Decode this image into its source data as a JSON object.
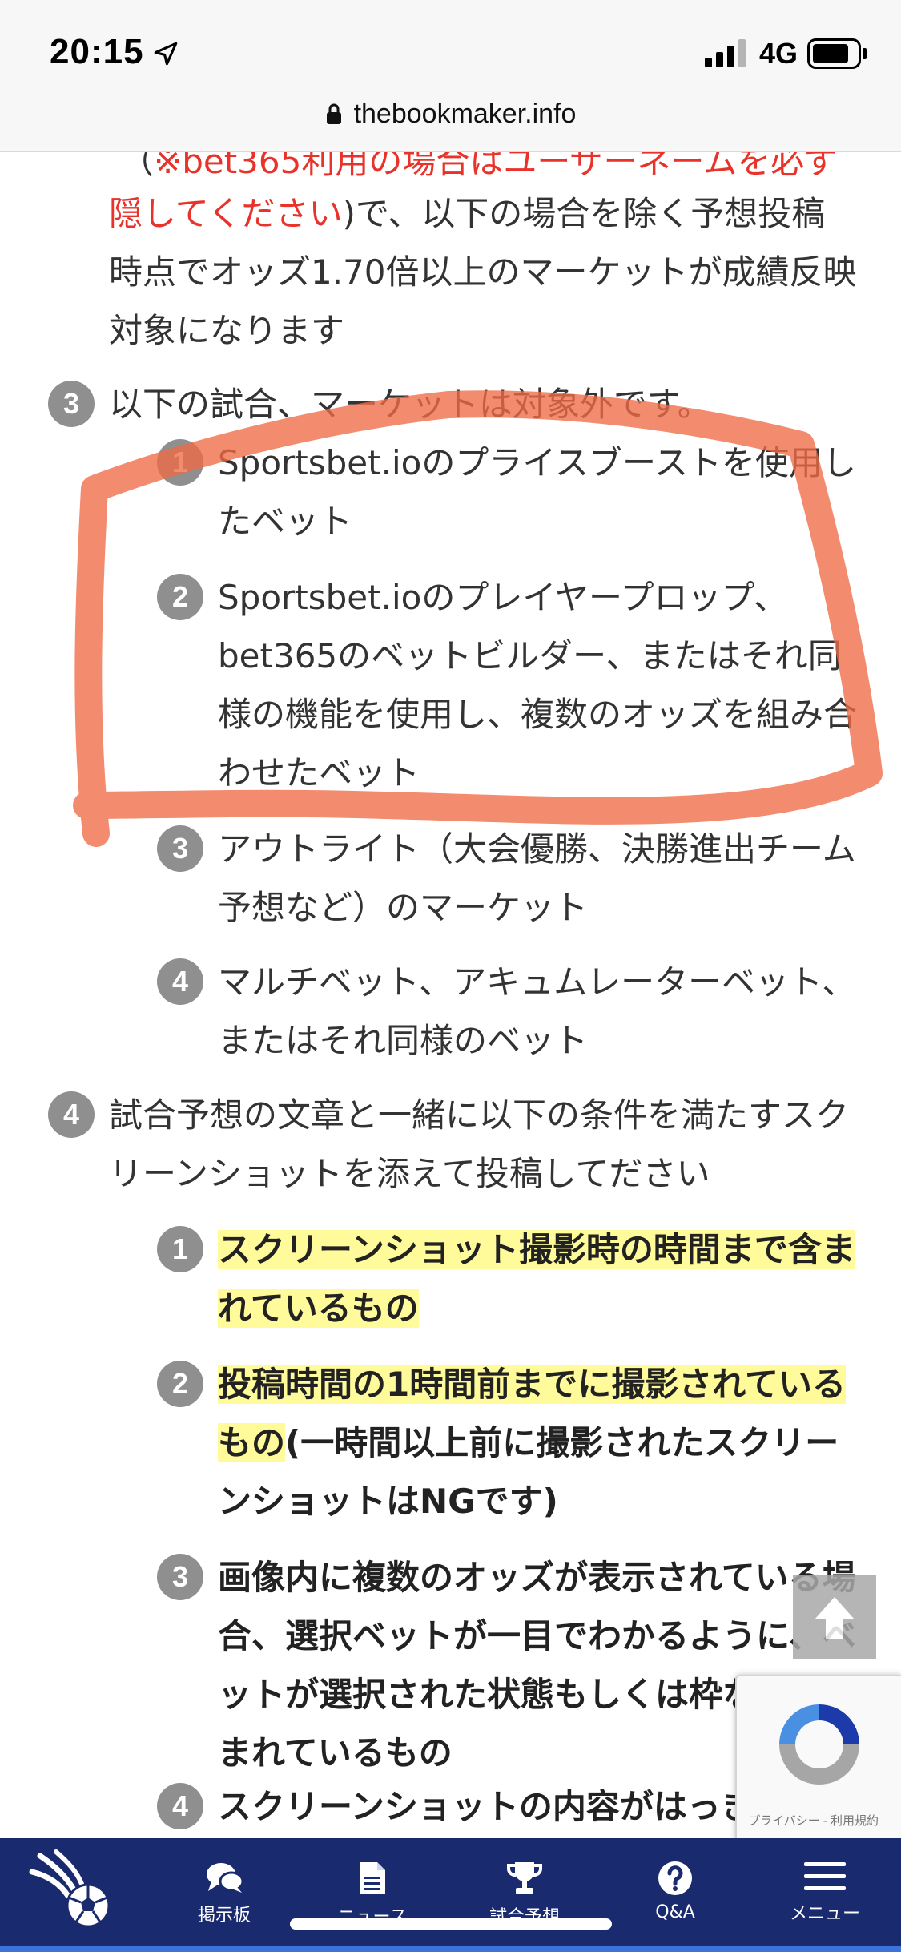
{
  "status_bar": {
    "time": "20:15",
    "network": "4G"
  },
  "url_bar": {
    "url": "thebookmaker.info"
  },
  "article": {
    "intro_paren_partial": "（",
    "intro_red_partial": "※bet365利用の場合はユーザーネームを必ず",
    "intro_red_line2": "隠してください",
    "intro_line2_rest": ")で、以下の場合を除く予想投稿",
    "intro_line3": "時点でオッズ1.70倍以上のマーケットが成績反映",
    "intro_line4": "対象になります",
    "section3": {
      "number": "3",
      "title": "以下の試合、マーケットは対象外です。",
      "items": [
        {
          "number": "1",
          "lines": [
            "Sportsbet.ioのプライスブーストを使用し",
            "たベット"
          ]
        },
        {
          "number": "2",
          "lines": [
            "Sportsbet.ioのプレイヤープロップ、",
            "bet365のベットビルダー、またはそれ同",
            "様の機能を使用し、複数のオッズを組み合",
            "わせたベット"
          ]
        },
        {
          "number": "3",
          "lines": [
            "アウトライト（大会優勝、決勝進出チーム",
            "予想など）のマーケット"
          ]
        },
        {
          "number": "4",
          "lines": [
            "マルチベット、アキュムレーターベット、",
            "またはそれ同様のベット"
          ]
        }
      ]
    },
    "section4": {
      "number": "4",
      "title_line1": "試合予想の文章と一緒に以下の条件を満たすスク",
      "title_line2": "リーンショットを添えて投稿してださい",
      "items": [
        {
          "number": "1",
          "hl_line1": "スクリーンショット撮影時の時間まで含ま",
          "hl_line2": "れているもの"
        },
        {
          "number": "2",
          "hl_line1": "投稿時間の1時間前までに撮影されている",
          "hl_line2": "もの",
          "rest_line2": "(一時間以上前に撮影されたスクリー",
          "line3": "ンショットはNGです)"
        },
        {
          "number": "3",
          "lines": [
            "画像内に複数のオッズが表示されている場",
            "合、選択ベットが一目でわかるように、ベ",
            "ットが選択された状態もしくは枠などで囲",
            "まれているもの"
          ]
        },
        {
          "number": "4",
          "lines": [
            "スクリーンショットの内容がはっきり読み"
          ]
        }
      ]
    }
  },
  "recaptcha": {
    "label": "プライバシー - 利用規約"
  },
  "bottom_nav": {
    "items": [
      {
        "label": "掲示板",
        "icon": "chat-bubbles-icon"
      },
      {
        "label": "ニュース",
        "icon": "document-icon"
      },
      {
        "label": "試合予想",
        "icon": "trophy-icon"
      },
      {
        "label": "Q&A",
        "icon": "question-icon"
      },
      {
        "label": "メニュー",
        "icon": "hamburger-menu-icon"
      }
    ]
  },
  "colors": {
    "accent_red": "#e8322a",
    "highlight": "#fffb9a",
    "nav_bg": "#1a2a6e",
    "marker_orange": "#f06a45"
  }
}
